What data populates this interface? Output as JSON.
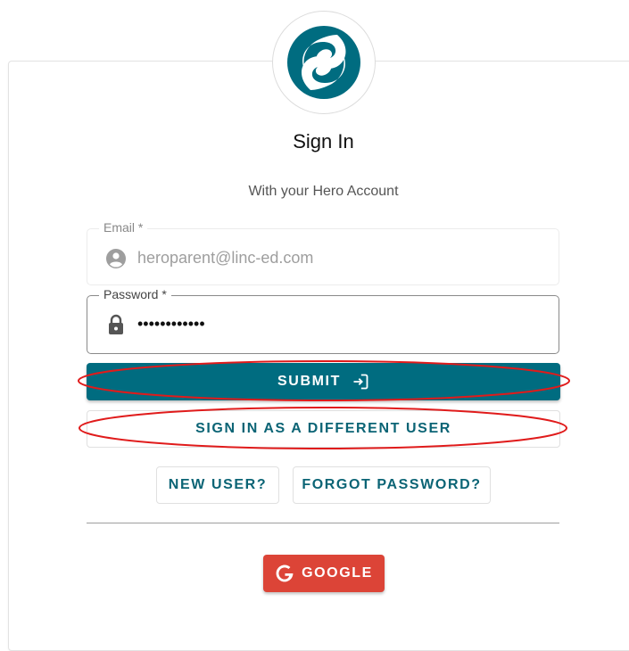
{
  "header": {
    "title": "Sign In",
    "subtitle": "With your Hero Account"
  },
  "email": {
    "label": "Email *",
    "value": "heroparent@linc-ed.com",
    "icon": "account-circle-icon"
  },
  "password": {
    "label": "Password *",
    "value": "••••••••••••",
    "icon": "lock-icon"
  },
  "buttons": {
    "submit": "SUBMIT",
    "different_user": "SIGN IN AS A DIFFERENT USER",
    "new_user": "NEW USER?",
    "forgot_password": "FORGOT PASSWORD?",
    "google": "GOOGLE"
  },
  "colors": {
    "primary": "#006c80",
    "google": "#dc4437",
    "annotation": "#e01b1b"
  }
}
